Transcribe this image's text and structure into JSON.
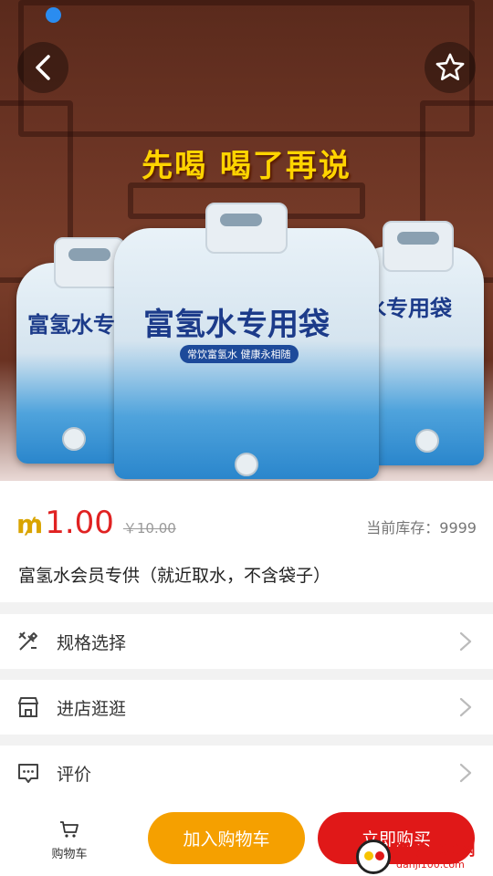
{
  "hero": {
    "caption": "先喝 喝了再说",
    "bag_label": "富氢水专用袋",
    "bag_label_left": "富氢水专",
    "bag_label_right": "水专用袋",
    "bag_sub": "常饮富氢水 健康永相随"
  },
  "product": {
    "currency_symbol": "₥",
    "price": "1.00",
    "original_price": "￥10.00",
    "stock": "当前库存：9999",
    "title": "富氢水会员专供（就近取水，不含袋子）"
  },
  "options": [
    {
      "label": "规格选择",
      "icon": "spec-icon"
    },
    {
      "label": "进店逛逛",
      "icon": "store-icon"
    },
    {
      "label": "评价",
      "icon": "comment-icon"
    }
  ],
  "bottom_bar": {
    "cart_label": "购物车",
    "add_to_cart": "加入购物车",
    "buy_now": "立即购买"
  },
  "watermark": {
    "line1": "单机100网",
    "line2": "danji100.com"
  },
  "colors": {
    "price_red": "#e02222",
    "add_button": "#f5a000",
    "buy_button": "#e01818",
    "coin_gold": "#d9a400"
  }
}
